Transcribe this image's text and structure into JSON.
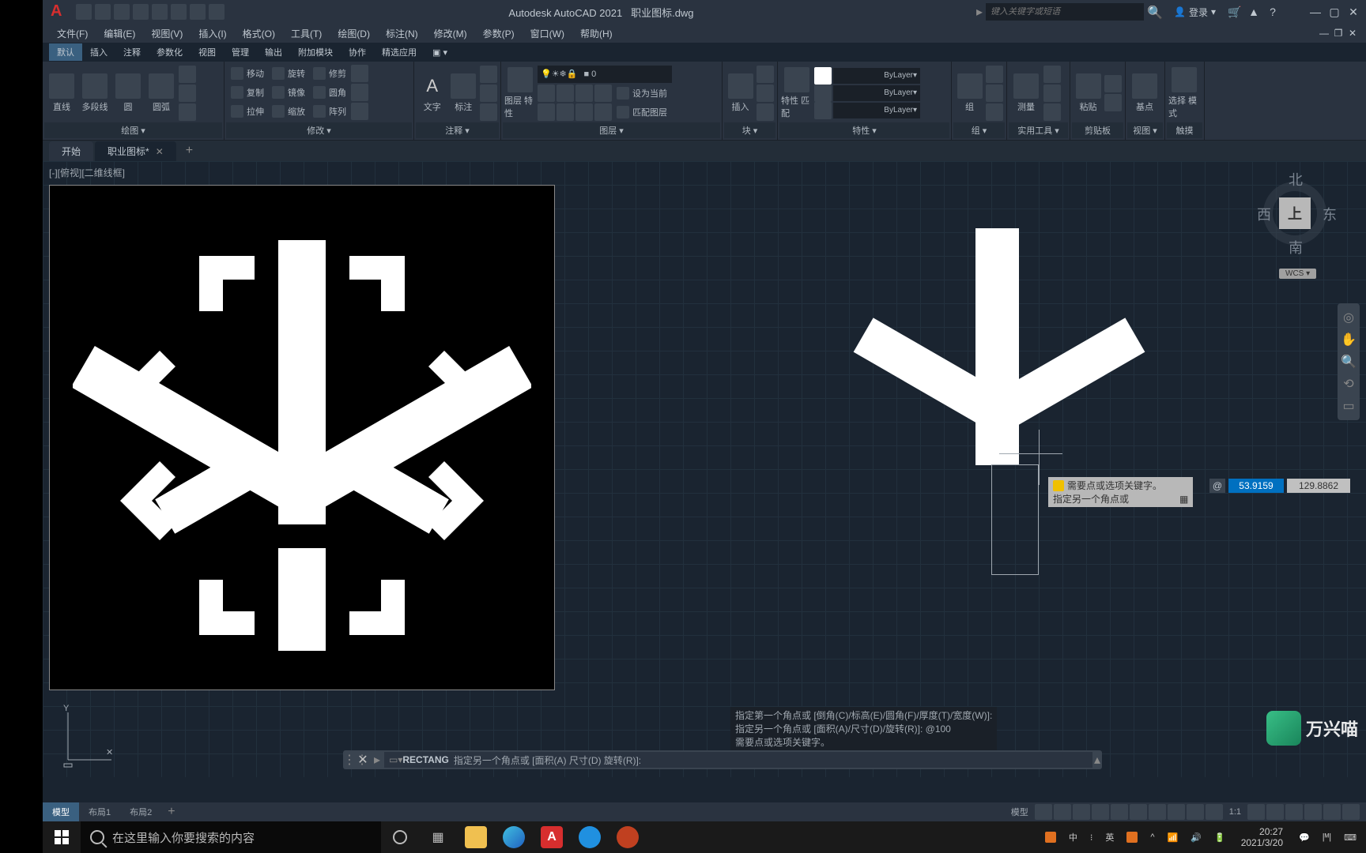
{
  "titlebar": {
    "app_name": "Autodesk AutoCAD 2021",
    "doc_name": "职业图标.dwg",
    "search_placeholder": "键入关键字或短语",
    "login": "登录"
  },
  "menus": [
    "文件(F)",
    "编辑(E)",
    "视图(V)",
    "插入(I)",
    "格式(O)",
    "工具(T)",
    "绘图(D)",
    "标注(N)",
    "修改(M)",
    "参数(P)",
    "窗口(W)",
    "帮助(H)"
  ],
  "ribbon_tabs": [
    "默认",
    "插入",
    "注释",
    "参数化",
    "视图",
    "管理",
    "输出",
    "附加模块",
    "协作",
    "精选应用"
  ],
  "panels": {
    "draw": {
      "label": "绘图 ▾",
      "items": [
        "直线",
        "多段线",
        "圆",
        "圆弧"
      ]
    },
    "modify": {
      "label": "修改 ▾",
      "move": "移动",
      "rotate": "旋转",
      "trim": "修剪",
      "copy": "复制",
      "mirror": "镜像",
      "fillet": "圆角",
      "stretch": "拉伸",
      "scale": "缩放",
      "array": "阵列"
    },
    "annot": {
      "label": "注释 ▾",
      "text": "文字",
      "dim": "标注"
    },
    "layer": {
      "label": "图层 ▾",
      "props": "图层\n特性",
      "current": "设为当前",
      "match": "匹配图层",
      "sel": "■ 0"
    },
    "block": {
      "label": "块 ▾",
      "insert": "插入"
    },
    "props": {
      "label": "特性 ▾",
      "match": "特性\n匹配",
      "bylayer": "ByLayer"
    },
    "group": {
      "label": "组 ▾",
      "group": "组"
    },
    "util": {
      "label": "实用工具 ▾",
      "measure": "测量"
    },
    "clip": {
      "label": "剪贴板",
      "paste": "粘贴"
    },
    "view": {
      "label": "视图 ▾",
      "base": "基点"
    },
    "touch": {
      "label": "触摸",
      "mode": "选择\n模式"
    }
  },
  "filetabs": {
    "start": "开始",
    "file": "职业图标*"
  },
  "viewport": "[-][俯视][二维线框]",
  "viewcube": {
    "n": "北",
    "s": "南",
    "e": "东",
    "w": "西",
    "top": "上",
    "wcs": "WCS ▾"
  },
  "cmd_history": [
    "指定第一个角点或 [倒角(C)/标高(E)/圆角(F)/厚度(T)/宽度(W)]:",
    "指定另一个角点或 [面积(A)/尺寸(D)/旋转(R)]: @100",
    "需要点或选项关键字。"
  ],
  "dyn_input": {
    "warn": "需要点或选项关键字。",
    "prompt": "指定另一个角点或",
    "at": "@",
    "x": "53.9159",
    "y": "129.8862"
  },
  "cmdline": {
    "cmd": "RECTANG",
    "prompt": "指定另一个角点或 [面积(A) 尺寸(D) 旋转(R)]:"
  },
  "modeltabs": {
    "model": "模型",
    "l1": "布局1",
    "l2": "布局2"
  },
  "status": {
    "model": "模型",
    "zoom": "1:1",
    "ime": "英"
  },
  "watermark": "万兴喵",
  "taskbar": {
    "search": "在这里输入你要搜索的内容",
    "time": "20:27",
    "date": "2021/3/20",
    "ime1": "中",
    "ime2": "英"
  }
}
